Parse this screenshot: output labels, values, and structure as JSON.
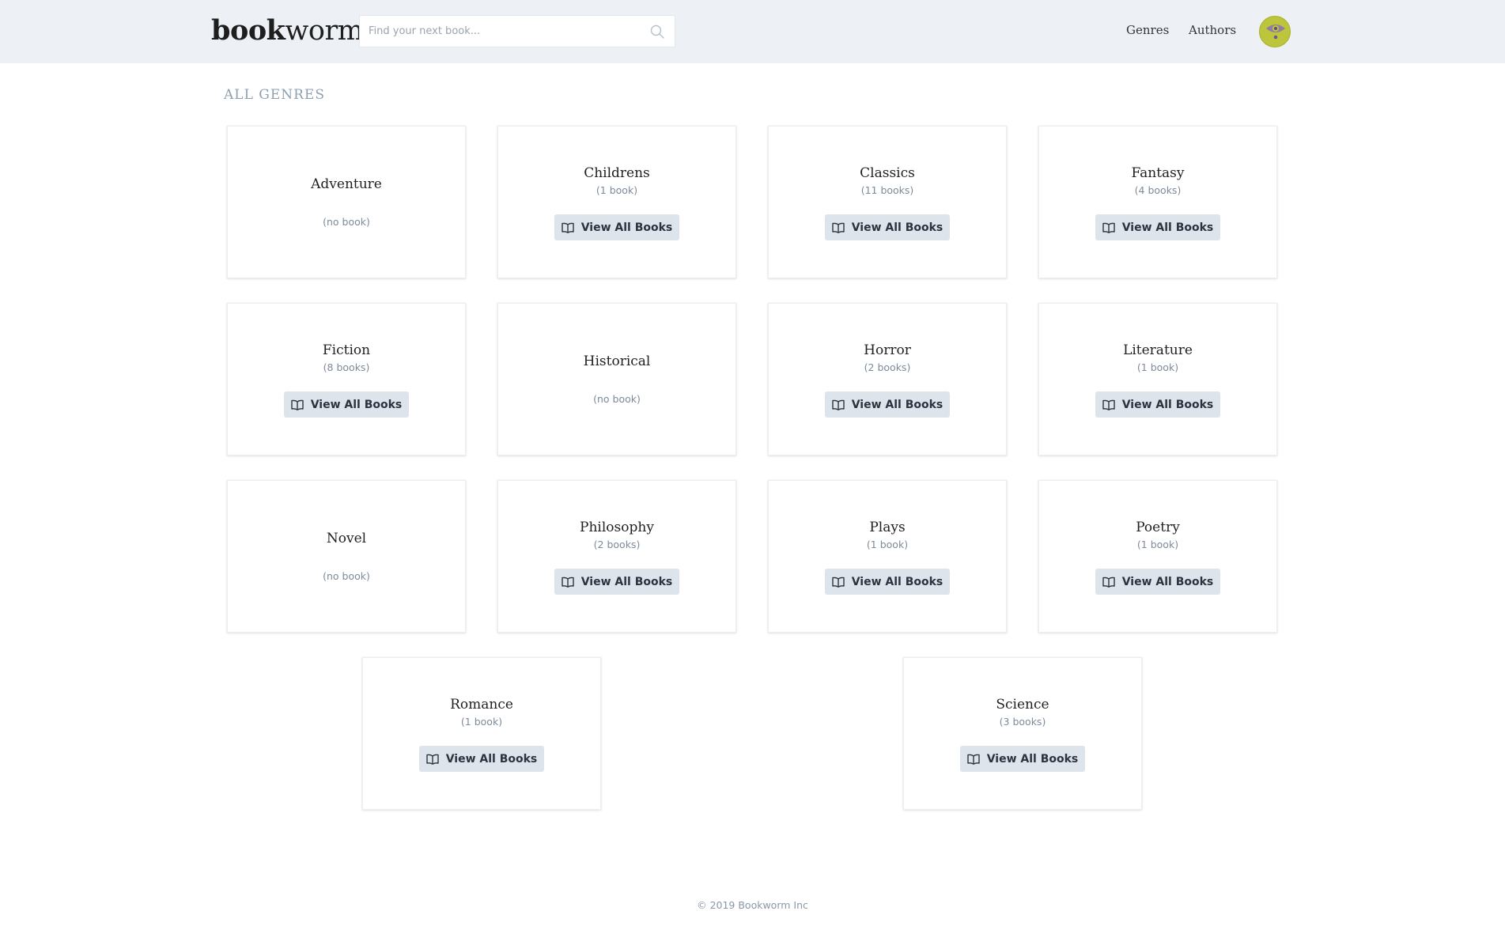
{
  "header": {
    "logo_bold": "book",
    "logo_light": "worm",
    "search_placeholder": "Find your next book...",
    "nav": [
      "Genres",
      "Authors"
    ],
    "avatar_icon": "eye-avatar-icon"
  },
  "page": {
    "section_title": "ALL GENRES",
    "button_label": "View All Books",
    "button_icon": "book-open-icon"
  },
  "genres": [
    {
      "name": "Adventure",
      "count": "(no book)"
    },
    {
      "name": "Childrens",
      "count": "(1 book)"
    },
    {
      "name": "Classics",
      "count": "(11 books)"
    },
    {
      "name": "Fantasy",
      "count": "(4 books)"
    },
    {
      "name": "Fiction",
      "count": "(8 books)"
    },
    {
      "name": "Historical",
      "count": "(no book)"
    },
    {
      "name": "Horror",
      "count": "(2 books)"
    },
    {
      "name": "Literature",
      "count": "(1 book)"
    },
    {
      "name": "Novel",
      "count": "(no book)"
    },
    {
      "name": "Philosophy",
      "count": "(2 books)"
    },
    {
      "name": "Plays",
      "count": "(1 book)"
    },
    {
      "name": "Poetry",
      "count": "(1 book)"
    },
    {
      "name": "Romance",
      "count": "(1 book)"
    },
    {
      "name": "Science",
      "count": "(3 books)"
    }
  ],
  "footer": {
    "text": "© 2019 Bookworm Inc"
  },
  "colors": {
    "header_bg": "#edf1f5",
    "button_bg": "#dde4eb",
    "avatar_bg": "#bdc53a",
    "muted_text": "#8e9fb2"
  }
}
